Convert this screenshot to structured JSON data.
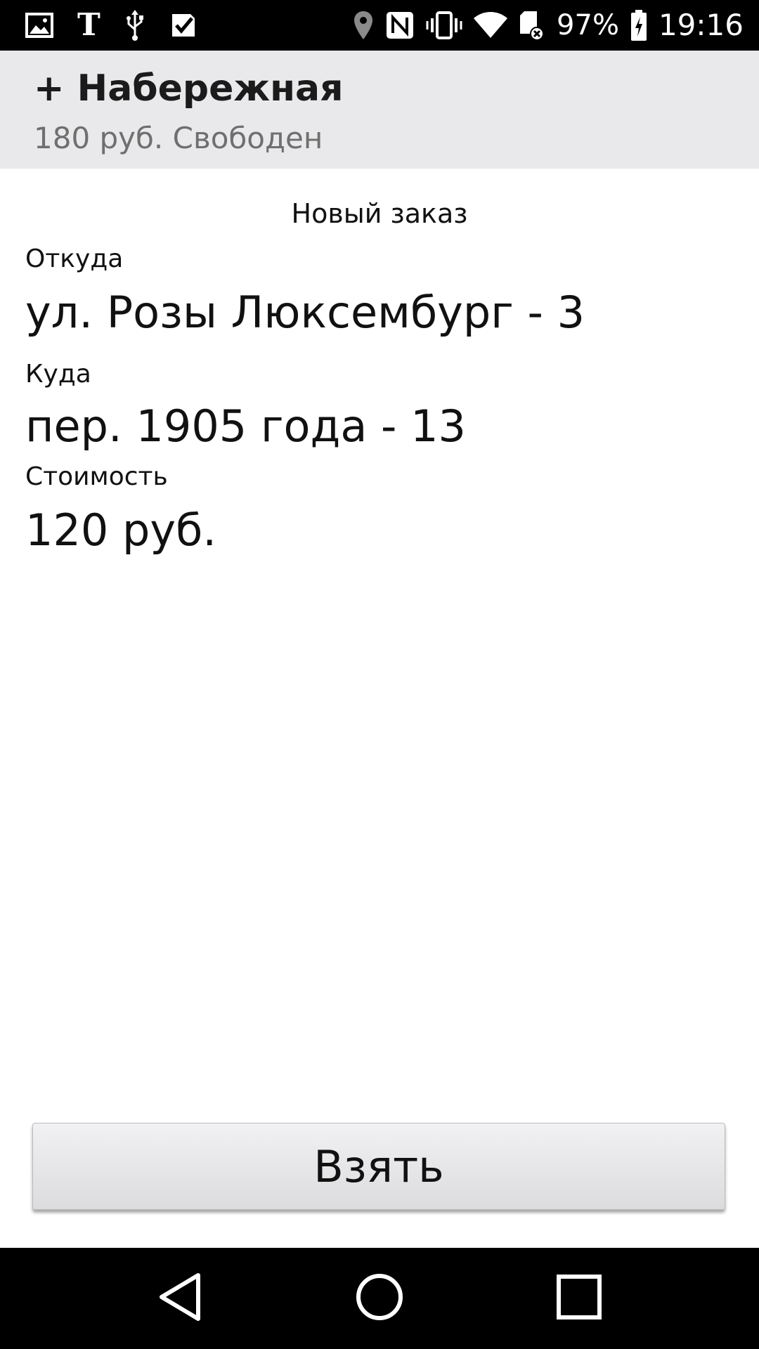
{
  "status_bar": {
    "left_icons": [
      "image-icon",
      "text-icon",
      "usb-icon",
      "check-icon"
    ],
    "right_icons": [
      "location-icon",
      "nfc-icon",
      "vibrate-icon",
      "wifi-icon",
      "sd-card-icon"
    ],
    "battery_percent": "97%",
    "battery_icon": "battery-charging-icon",
    "time": "19:16"
  },
  "header": {
    "title": "+ Набережная",
    "subtitle": "180 руб. Свободен"
  },
  "order": {
    "heading": "Новый заказ",
    "from_label": "Откуда",
    "from_value": "ул. Розы Люксембург - 3",
    "to_label": "Куда",
    "to_value": "пер. 1905 года - 13",
    "cost_label": "Стоимость",
    "cost_value": "120 руб."
  },
  "actions": {
    "take_label": "Взять"
  },
  "nav_bar": {
    "back_icon": "back-triangle-icon",
    "home_icon": "home-circle-icon",
    "recent_icon": "recent-square-icon"
  }
}
